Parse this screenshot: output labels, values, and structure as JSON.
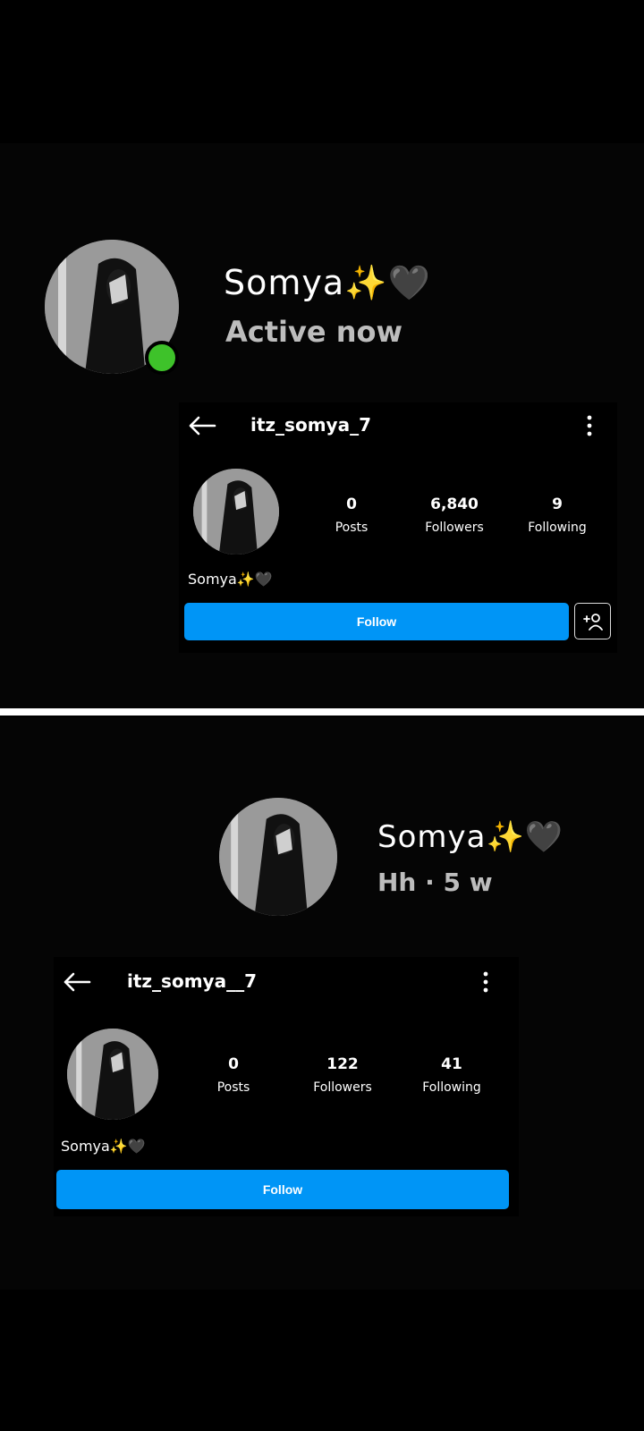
{
  "top": {
    "display_name": "Somya✨🖤",
    "status": "Active now",
    "username": "itz_somya_7",
    "stats": [
      {
        "value": "0",
        "label": "Posts"
      },
      {
        "value": "6,840",
        "label": "Followers"
      },
      {
        "value": "9",
        "label": "Following"
      }
    ],
    "bio_name": "Somya✨🖤",
    "follow_label": "Follow",
    "online_color": "#3ec22a"
  },
  "bottom": {
    "display_name": "Somya✨🖤",
    "status": "Hh · 5 w",
    "username": "itz_somya__7",
    "stats": [
      {
        "value": "0",
        "label": "Posts"
      },
      {
        "value": "122",
        "label": "Followers"
      },
      {
        "value": "41",
        "label": "Following"
      }
    ],
    "bio_name": "Somya✨🖤",
    "follow_label": "Follow"
  },
  "colors": {
    "follow_button": "#0095f6",
    "background": "#000000",
    "divider": "#ffffff"
  },
  "icons": [
    "back-arrow-icon",
    "more-vertical-icon",
    "add-user-icon"
  ]
}
